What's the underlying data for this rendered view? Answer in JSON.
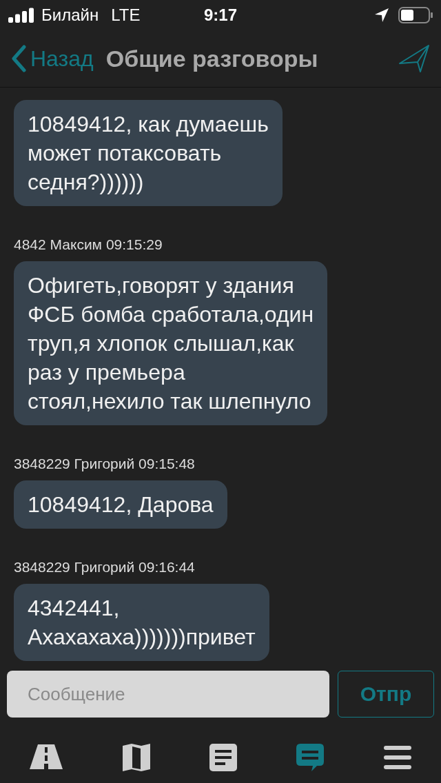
{
  "status_bar": {
    "carrier": "Билайн",
    "network": "LTE",
    "time": "9:17"
  },
  "nav": {
    "back": "Назад",
    "title": "Общие разговоры"
  },
  "messages": [
    {
      "lines": [
        "10849412, как думаешь",
        "может потаксовать",
        "седня?))))))"
      ]
    },
    {
      "meta": "4842 Максим 09:15:29",
      "lines": [
        "Офигеть,говорят у здания",
        "ФСБ бомба сработала,один",
        "труп,я хлопок слышал,как",
        "раз у премьера",
        "стоял,нехило так шлепнуло"
      ]
    },
    {
      "meta": "3848229 Григорий 09:15:48",
      "lines": [
        "10849412, Дарова"
      ]
    },
    {
      "meta": "3848229 Григорий 09:16:44",
      "lines": [
        "4342441,",
        "Ахахахаха)))))))привет"
      ]
    }
  ],
  "composer": {
    "placeholder": "Сообщение",
    "send": "Отпр"
  },
  "tabs": [
    {
      "selected": false
    },
    {
      "selected": false
    },
    {
      "selected": false
    },
    {
      "selected": true
    },
    {
      "selected": false
    }
  ]
}
